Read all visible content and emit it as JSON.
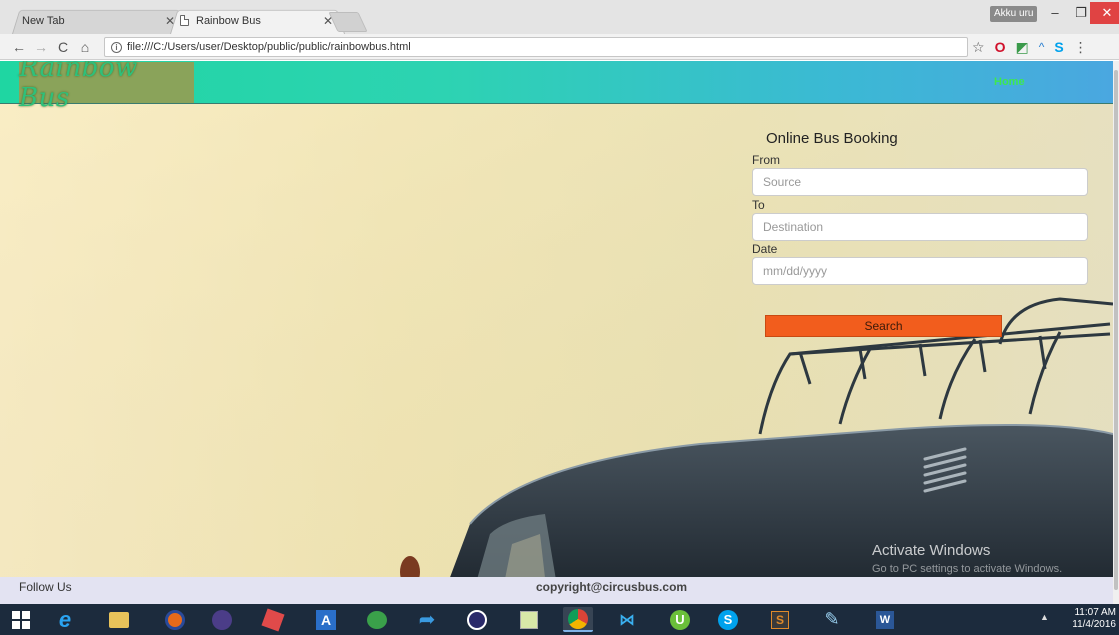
{
  "browser": {
    "tabs": [
      {
        "label": "New Tab",
        "active": false
      },
      {
        "label": "Rainbow Bus",
        "active": true
      }
    ],
    "profile_name": "Akku uru",
    "url": "file:///C:/Users/user/Desktop/public/public/rainbowbus.html"
  },
  "site": {
    "logo_text": "Rainbow Bus",
    "nav_home": "Home",
    "form": {
      "title": "Online Bus Booking",
      "from_label": "From",
      "from_placeholder": "Source",
      "to_label": "To",
      "to_placeholder": "Destination",
      "date_label": "Date",
      "date_placeholder": "mm/dd/yyyy",
      "search_label": "Search"
    },
    "footer": {
      "follow": "Follow Us",
      "copyright": "copyright@circusbus.com"
    }
  },
  "watermark": {
    "line1": "Activate Windows",
    "line2": "Go to PC settings to activate Windows."
  },
  "taskbar": {
    "time": "11:07 AM",
    "date": "11/4/2016"
  },
  "colors": {
    "header_start": "#1fd6a2",
    "header_end": "#4aa7e0",
    "logo_bg": "#8aa35a",
    "search_button": "#f25d1d",
    "home_link": "#3ee84e"
  }
}
